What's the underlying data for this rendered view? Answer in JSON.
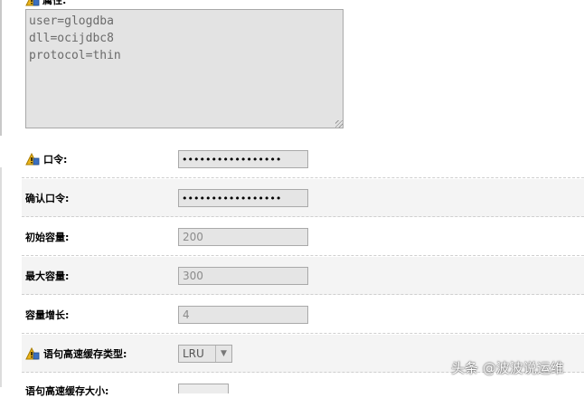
{
  "attributes": {
    "label": "属性:",
    "value": "user=glogdba\ndll=ocijdbc8\nprotocol=thin"
  },
  "fields": {
    "password": {
      "label": "口令:",
      "value": "•••••••••••••••••"
    },
    "confirm_password": {
      "label": "确认口令:",
      "value": "•••••••••••••••••"
    },
    "initial_capacity": {
      "label": "初始容量:",
      "value": "200"
    },
    "max_capacity": {
      "label": "最大容量:",
      "value": "300"
    },
    "capacity_increment": {
      "label": "容量增长:",
      "value": "4"
    },
    "statement_cache_type": {
      "label": "语句高速缓存类型:",
      "value": "LRU"
    },
    "statement_cache_size": {
      "label": "语句高速缓存大小:"
    }
  },
  "watermark": "头条 @波波说运维",
  "colors": {
    "icon_gold": "#e9b21a",
    "icon_blue": "#3a6fc1"
  }
}
